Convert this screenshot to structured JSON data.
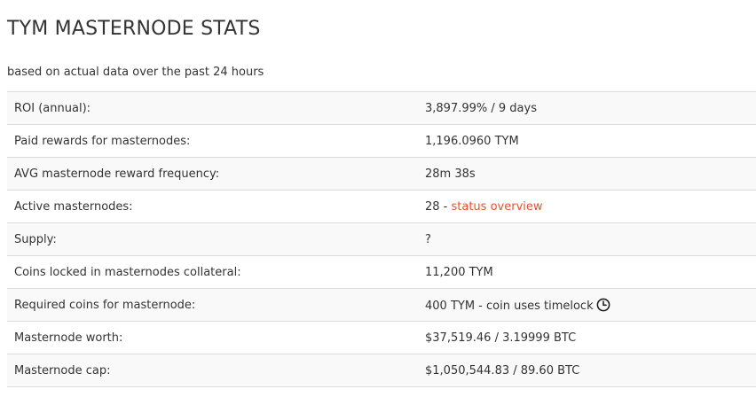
{
  "page": {
    "title": "TYM MASTERNODE STATS",
    "subtitle": "based on actual data over the past 24 hours"
  },
  "stats": {
    "rows": [
      {
        "label": "ROI (annual):",
        "value": "3,897.99% / 9 days"
      },
      {
        "label": "Paid rewards for masternodes:",
        "value": "1,196.0960 TYM"
      },
      {
        "label": "AVG masternode reward frequency:",
        "value": "28m 38s"
      },
      {
        "label": "Active masternodes:",
        "value": "28 - ",
        "link": "status overview"
      },
      {
        "label": "Supply:",
        "value": "?"
      },
      {
        "label": "Coins locked in masternodes collateral:",
        "value": "11,200 TYM"
      },
      {
        "label": "Required coins for masternode:",
        "value": "400 TYM - coin uses timelock",
        "icon": "clock-icon"
      },
      {
        "label": "Masternode worth:",
        "value": "$37,519.46 / 3.19999 BTC"
      },
      {
        "label": "Masternode cap:",
        "value": "$1,050,544.83 / 89.60 BTC"
      }
    ]
  },
  "colors": {
    "link": "#e0552a",
    "stripe": "#f9f9f9",
    "border": "#dddddd",
    "text": "#333333"
  }
}
